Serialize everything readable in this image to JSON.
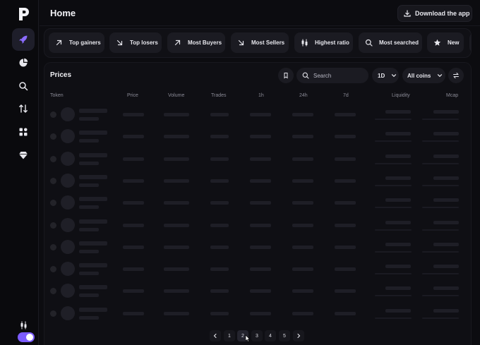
{
  "header": {
    "title": "Home",
    "download_label": "Download the app"
  },
  "filters": [
    {
      "label": "Top gainers",
      "icon": "arrow-up-right-icon"
    },
    {
      "label": "Top losers",
      "icon": "arrow-down-right-icon"
    },
    {
      "label": "Most Buyers",
      "icon": "arrow-up-right-icon"
    },
    {
      "label": "Most Sellers",
      "icon": "arrow-down-right-icon"
    },
    {
      "label": "Highest ratio",
      "icon": "candles-icon"
    },
    {
      "label": "Most searched",
      "icon": "search-icon"
    },
    {
      "label": "New",
      "icon": "star-icon"
    }
  ],
  "prices": {
    "title": "Prices",
    "search_placeholder": "Search",
    "timeframe": "1D",
    "coins_filter": "All coins",
    "columns": [
      "Token",
      "Price",
      "Volume",
      "Trades",
      "1h",
      "24h",
      "7d",
      "Liquidity",
      "Mcap"
    ],
    "loading_rows": 10
  },
  "pagination": {
    "pages": [
      "1",
      "2",
      "3",
      "4",
      "5"
    ],
    "current": "2"
  },
  "sidebar": {
    "items": [
      "rocket-icon",
      "pie-chart-icon",
      "search-icon",
      "swap-icon",
      "grid-icon",
      "gem-icon"
    ],
    "bottom_icon": "candles-icon",
    "theme_toggle_on": true
  },
  "colors": {
    "accent": "#7c5cff",
    "background": "#0c0c10",
    "surface": "#1b1b22"
  }
}
